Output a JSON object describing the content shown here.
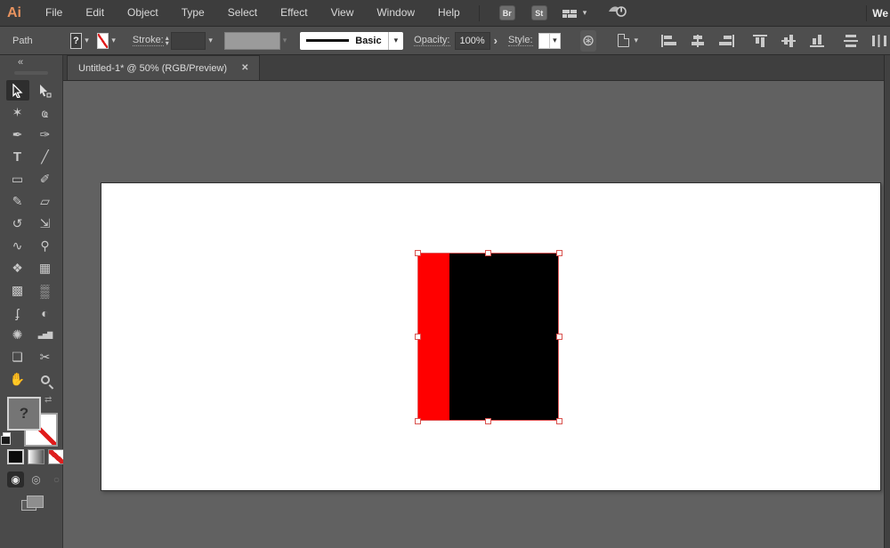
{
  "menu_bar": {
    "logo": "Ai",
    "items": [
      "File",
      "Edit",
      "Object",
      "Type",
      "Select",
      "Effect",
      "View",
      "Window",
      "Help"
    ],
    "bridge_button": "Br",
    "stock_button": "St",
    "workspace_truncated": "We"
  },
  "control_bar": {
    "context_label": "Path",
    "fill_unknown": "?",
    "stroke_label": "Stroke:",
    "brush_name": "Basic",
    "opacity_label": "Opacity:",
    "opacity_value": "100%",
    "style_label": "Style:"
  },
  "tab_bar": {
    "title": "Untitled-1* @ 50% (RGB/Preview)",
    "close": "✕"
  },
  "toolbar": {
    "collapse": "«",
    "fill_unknown": "?",
    "tools": [
      "selection",
      "direct-selection",
      "magic-wand",
      "lasso",
      "pen",
      "curvature",
      "type",
      "line-segment",
      "rectangle",
      "paintbrush",
      "pencil",
      "eraser",
      "rotate",
      "scale",
      "width",
      "puppet-warp",
      "shape-builder",
      "perspective-grid",
      "mesh",
      "gradient",
      "eyedropper",
      "blend",
      "symbol-sprayer",
      "column-graph",
      "artboard",
      "slice",
      "hand",
      "zoom"
    ],
    "selected_tool": "selection"
  },
  "icons": {
    "magic_wand": "✶",
    "lasso": "ҩ",
    "pen": "✒",
    "curvature": "✑",
    "type": "T",
    "line": "╱",
    "rectangle": "▭",
    "paintbrush": "✐",
    "pencil": "✎",
    "eraser": "▱",
    "rotate": "↺",
    "scale": "⇲",
    "width": "∿",
    "puppet_warp": "⚲",
    "shape_builder": "❖",
    "perspective_grid": "▦",
    "mesh": "▩",
    "gradient": "▒",
    "eyedropper": "ʄ",
    "blend": "◐",
    "symbol_sprayer": "✺",
    "column_graph": "▃▅▇",
    "artboard": "❏",
    "slice": "✂",
    "hand": "✋",
    "chevron_down": "▾",
    "stepper_up": "▴",
    "stepper_down": "▾",
    "opacity_arrow": "›",
    "swap_arrows": "⇄",
    "recolor_wheel": "⊛",
    "draw_normal": "◉",
    "draw_behind": "◎",
    "draw_inside": "○"
  },
  "artwork": {
    "left_fill_color": "#ff0000",
    "right_fill_color": "#000000",
    "selection_color": "#e25a5a",
    "artboard_color": "#ffffff"
  },
  "colors": {
    "menu_bar_bg": "#3d3d3d",
    "control_bar_bg": "#4e4e4e",
    "tab_bar_bg": "#3f3f3f",
    "toolbar_bg": "#4a4a4a",
    "pasteboard_bg": "#616161",
    "logo_orange": "#e8935f",
    "none_slash_red": "#e01b1b"
  }
}
